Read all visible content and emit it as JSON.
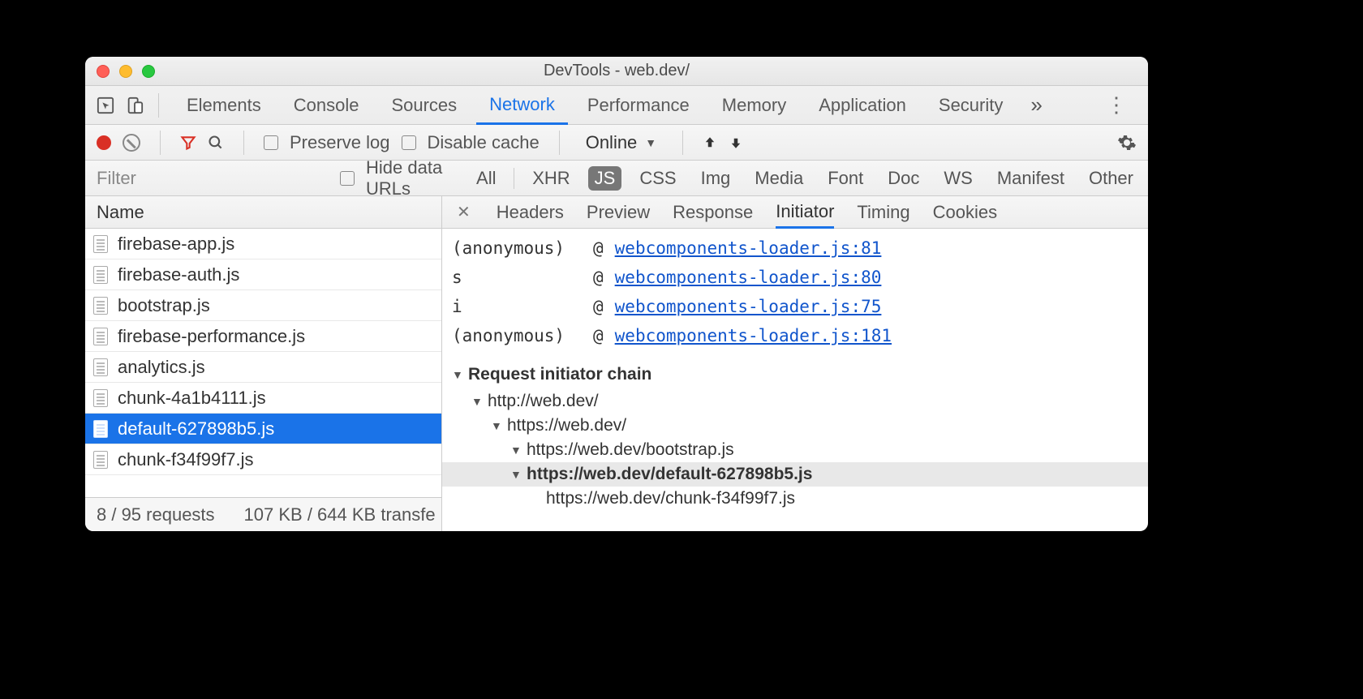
{
  "window": {
    "title": "DevTools - web.dev/"
  },
  "mainTabs": {
    "items": [
      "Elements",
      "Console",
      "Sources",
      "Network",
      "Performance",
      "Memory",
      "Application",
      "Security"
    ],
    "active": 3,
    "overflow": "»"
  },
  "netToolbar": {
    "preserve_log": "Preserve log",
    "disable_cache": "Disable cache",
    "throttle": "Online"
  },
  "filterRow": {
    "placeholder": "Filter",
    "hide_data_urls": "Hide data URLs",
    "types": [
      "All",
      "XHR",
      "JS",
      "CSS",
      "Img",
      "Media",
      "Font",
      "Doc",
      "WS",
      "Manifest",
      "Other"
    ],
    "activeType": 2
  },
  "requestList": {
    "header": "Name",
    "items": [
      "firebase-app.js",
      "firebase-auth.js",
      "bootstrap.js",
      "firebase-performance.js",
      "analytics.js",
      "chunk-4a1b4111.js",
      "default-627898b5.js",
      "chunk-f34f99f7.js"
    ],
    "selected": 6,
    "footer_requests": "8 / 95 requests",
    "footer_transfer": "107 KB / 644 KB transfe"
  },
  "detailTabs": {
    "items": [
      "Headers",
      "Preview",
      "Response",
      "Initiator",
      "Timing",
      "Cookies"
    ],
    "active": 3
  },
  "callstack": [
    {
      "fn": "(anonymous)",
      "at": "@",
      "link": "webcomponents-loader.js:81"
    },
    {
      "fn": "s",
      "at": "@",
      "link": "webcomponents-loader.js:80"
    },
    {
      "fn": "i",
      "at": "@",
      "link": "webcomponents-loader.js:75"
    },
    {
      "fn": "(anonymous)",
      "at": "@",
      "link": "webcomponents-loader.js:181"
    }
  ],
  "chainHeader": "Request initiator chain",
  "chain": {
    "n0": "http://web.dev/",
    "n1": "https://web.dev/",
    "n2": "https://web.dev/bootstrap.js",
    "n3": "https://web.dev/default-627898b5.js",
    "n4": "https://web.dev/chunk-f34f99f7.js"
  }
}
